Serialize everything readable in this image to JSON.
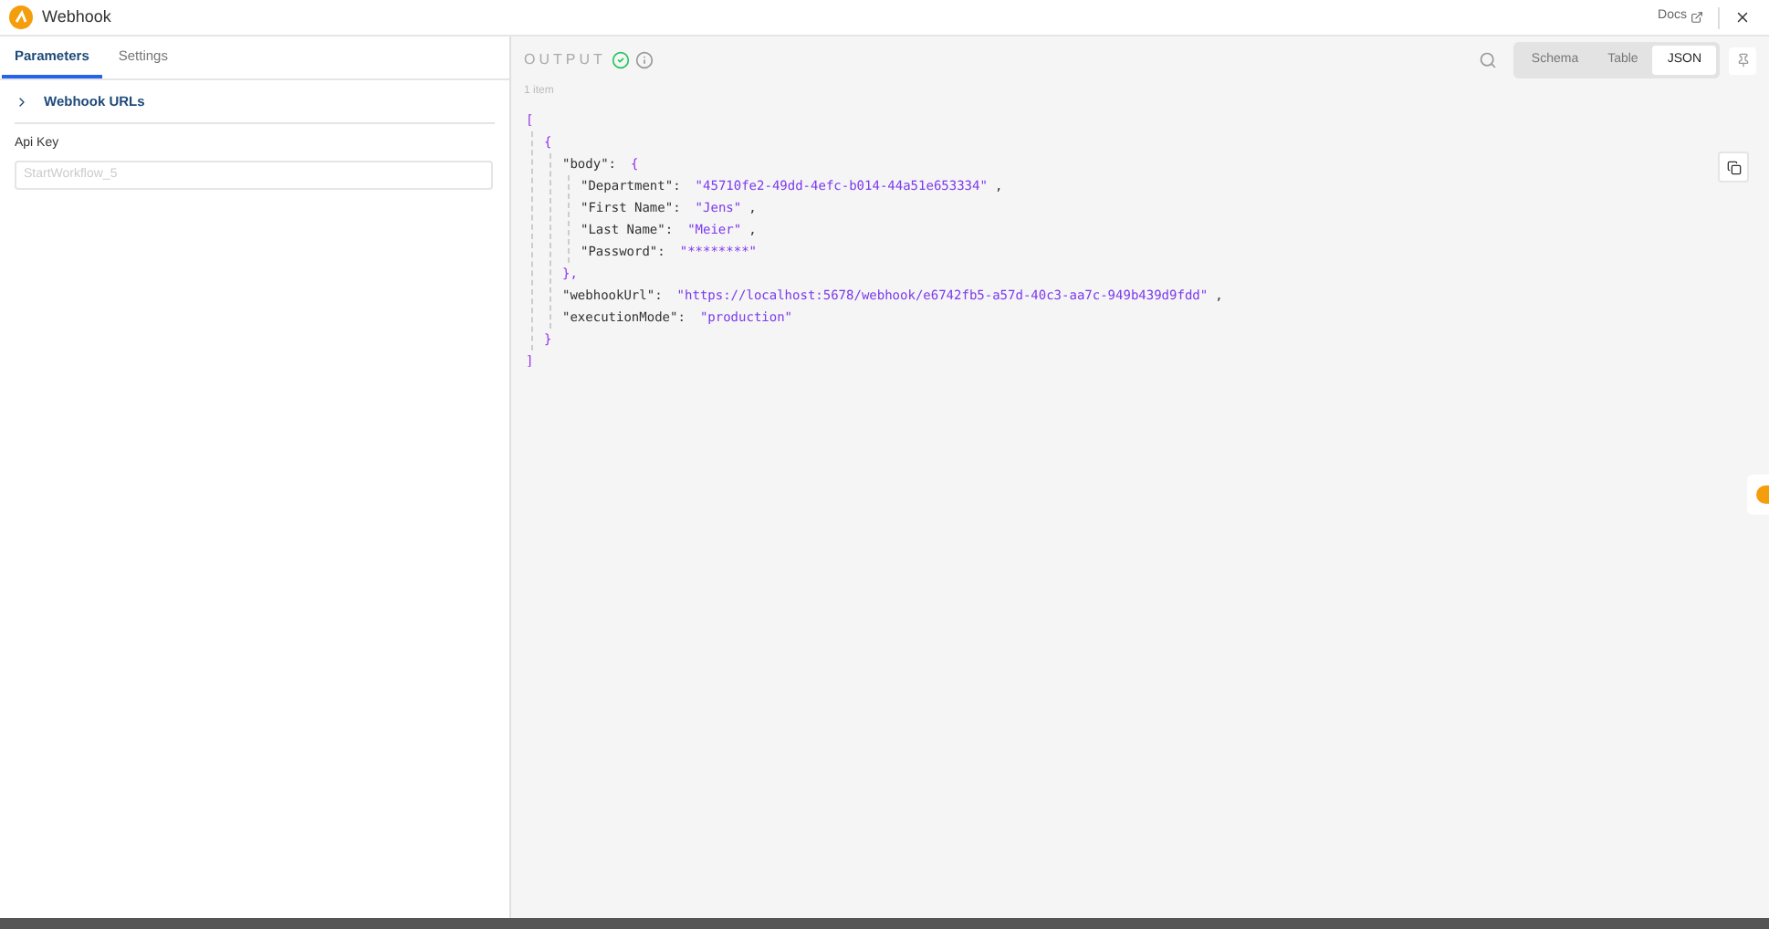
{
  "window": {
    "title": "Webhook",
    "docs_link": "Docs"
  },
  "tabs": [
    {
      "label": "Parameters",
      "selected": true
    },
    {
      "label": "Settings",
      "selected": false
    }
  ],
  "section": {
    "label": "Webhook URLs",
    "expanded": false
  },
  "api_key": {
    "label": "Api Key",
    "placeholder": "StartWorkflow_5"
  },
  "output": {
    "title": "OUTPUT",
    "count": "1 item",
    "views": [
      {
        "label": "Schema",
        "selected": false
      },
      {
        "label": "Table",
        "selected": false
      },
      {
        "label": "JSON",
        "selected": true
      }
    ],
    "json": {
      "open": "[",
      "close": "]",
      "children": [
        {
          "open": "{",
          "close": "}",
          "children": [
            {
              "key": "\"body\":",
              "open": "{",
              "close": "},",
              "children": [
                {
                  "key": "\"Department\":",
                  "value": "\"45710fe2-49dd-4efc-b014-44a51e653334\"",
                  "punct": ","
                },
                {
                  "key": "\"First Name\":",
                  "value": "\"Jens\"",
                  "punct": ","
                },
                {
                  "key": "\"Last Name\":",
                  "value": "\"Meier\"",
                  "punct": ","
                },
                {
                  "key": "\"Password\":",
                  "value": "\"********\""
                }
              ]
            },
            {
              "key": "\"webhookUrl\":",
              "value": "\"https://localhost:5678/webhook/e6742fb5-a57d-40c3-aa7c-949b439d9fdd\"",
              "punct": ","
            },
            {
              "key": "\"executionMode\":",
              "value": "\"production\""
            }
          ]
        }
      ]
    }
  }
}
